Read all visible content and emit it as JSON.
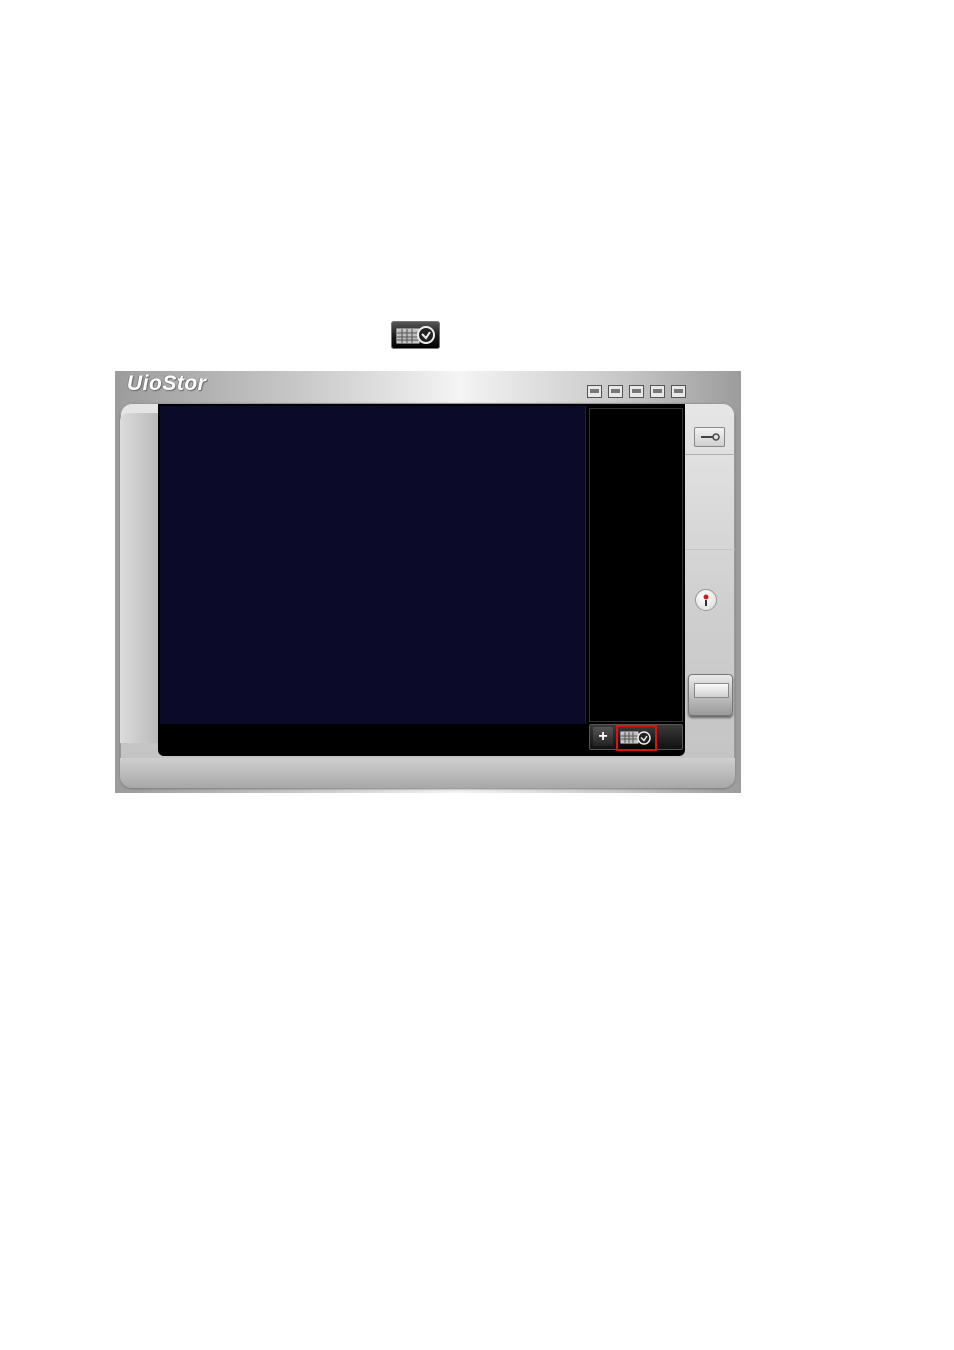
{
  "app": {
    "brand": "UioStor"
  },
  "toolbar": {
    "top_icons": [
      "layout-1x1-icon",
      "layout-2x2-icon",
      "layout-3x3-icon",
      "monitor-icon",
      "fullscreen-icon"
    ]
  },
  "controls": {
    "add_label": "+"
  },
  "colors": {
    "video_bg": "#0b0b29",
    "highlight": "#e01010"
  }
}
